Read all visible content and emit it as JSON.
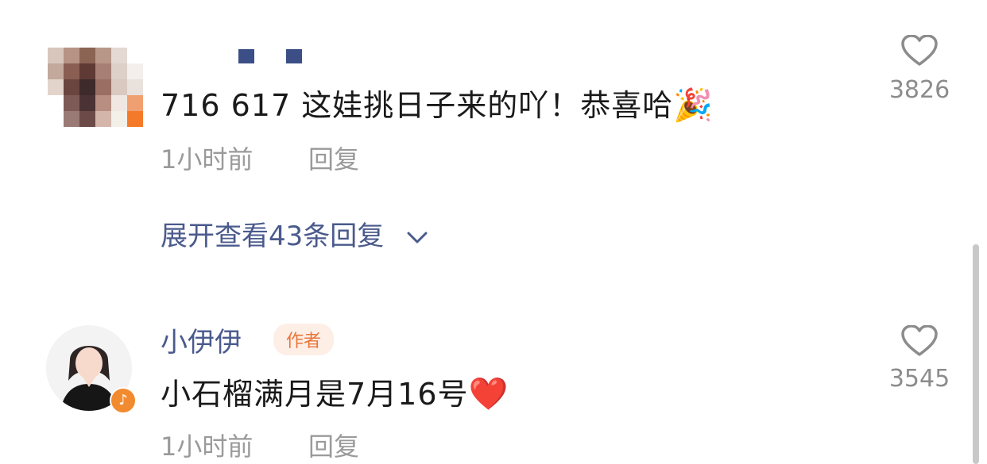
{
  "comments": [
    {
      "text": "716 617 这娃挑日子来的吖！恭喜哈",
      "emoji": "🎉",
      "time": "1小时前",
      "reply_label": "回复",
      "likes": "3826",
      "expand_label": "展开查看43条回复",
      "expand_icon": "chevron-down-icon"
    },
    {
      "username": "小伊伊",
      "badge": "作者",
      "text": "小石榴满月是7月16号",
      "emoji": "❤️",
      "time": "1小时前",
      "reply_label": "回复",
      "likes": "3545"
    }
  ],
  "colors": {
    "link": "#4a5a8c",
    "badge_bg": "#fdeee6",
    "badge_text": "#e8763a",
    "meta": "#9a9a9a"
  }
}
